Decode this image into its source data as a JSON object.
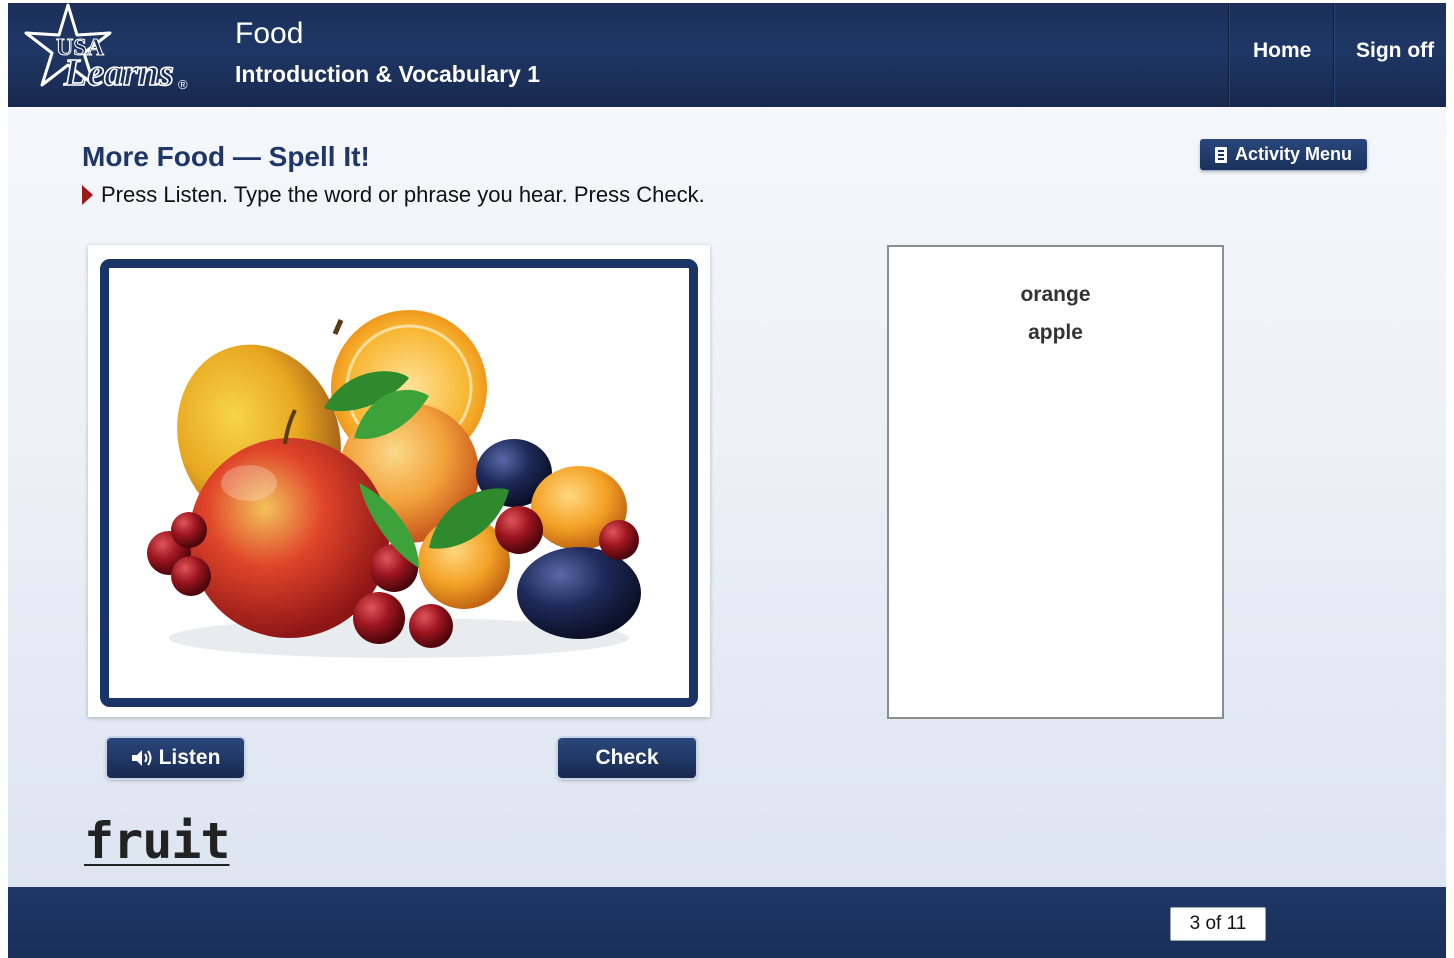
{
  "header": {
    "logo_text_top": "USA",
    "logo_text_bottom": "Learns",
    "logo_registered": "®",
    "course_title": "Food",
    "course_subtitle": "Introduction & Vocabulary 1",
    "nav": {
      "home": "Home",
      "sign_off": "Sign off"
    }
  },
  "activity": {
    "title": "More Food — Spell It!",
    "instruction": "Press Listen. Type the word or phrase you hear. Press Check.",
    "activity_menu_label": "Activity Menu"
  },
  "controls": {
    "listen_label": "Listen",
    "check_label": "Check"
  },
  "answer": {
    "value": "fruit"
  },
  "word_list": [
    "orange",
    "apple"
  ],
  "footer": {
    "counter": "3 of 11"
  },
  "colors": {
    "navy": "#1b2f5a",
    "accent_red": "#a01818",
    "title_blue": "#1e3768"
  }
}
